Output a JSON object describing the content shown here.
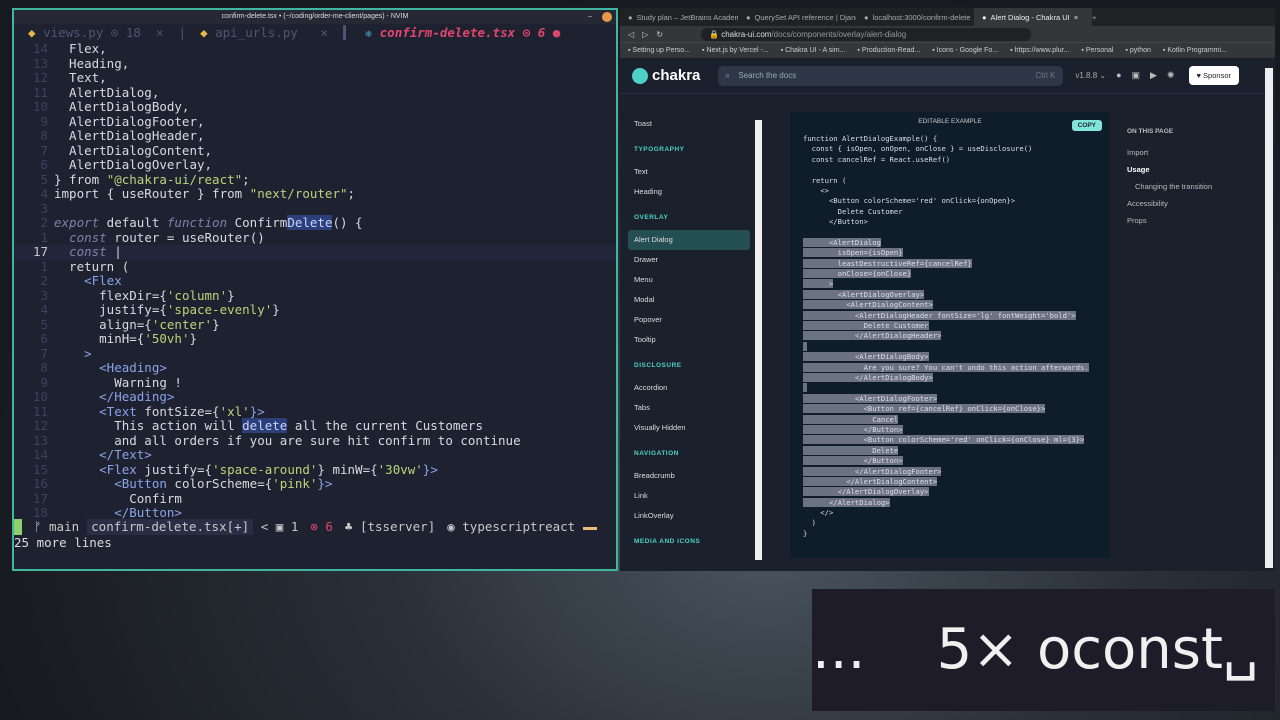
{
  "nvim": {
    "title": "confirm-delete.tsx • (~/coding/order-me-client/pages) - NVIM",
    "min": "–",
    "tabs": [
      {
        "label": "views.py ⊙ 18  ×",
        "icon": "python-icon",
        "active": false
      },
      {
        "label": "api_urls.py   ×",
        "icon": "python-icon",
        "active": false
      },
      {
        "label": "confirm-delete.tsx ⊙ 6 ●",
        "icon": "react-icon",
        "active": true
      }
    ],
    "lines": [
      {
        "n": "14",
        "s": [
          [
            "  Flex,",
            ""
          ]
        ]
      },
      {
        "n": "13",
        "s": [
          [
            "  Heading,",
            ""
          ]
        ]
      },
      {
        "n": "12",
        "s": [
          [
            "  Text,",
            ""
          ]
        ]
      },
      {
        "n": "11",
        "s": [
          [
            "  AlertDialog,",
            ""
          ]
        ]
      },
      {
        "n": "10",
        "s": [
          [
            "  AlertDialogBody,",
            ""
          ]
        ]
      },
      {
        "n": "9",
        "s": [
          [
            "  AlertDialogFooter,",
            ""
          ]
        ]
      },
      {
        "n": "8",
        "s": [
          [
            "  AlertDialogHeader,",
            ""
          ]
        ]
      },
      {
        "n": "7",
        "s": [
          [
            "  AlertDialogContent,",
            ""
          ]
        ]
      },
      {
        "n": "6",
        "s": [
          [
            "  AlertDialogOverlay,",
            ""
          ]
        ]
      },
      {
        "n": "5",
        "s": [
          [
            "} from ",
            ""
          ],
          [
            "\"@chakra-ui/react\"",
            "s"
          ],
          [
            ";",
            ""
          ]
        ]
      },
      {
        "n": "4",
        "s": [
          [
            "import { useRouter } from ",
            ""
          ],
          [
            "\"next/router\"",
            "s"
          ],
          [
            ";",
            ""
          ]
        ]
      },
      {
        "n": "3",
        "s": [
          [
            "",
            ""
          ]
        ]
      },
      {
        "n": "2",
        "s": [
          [
            "export",
            "k"
          ],
          [
            " default ",
            ""
          ],
          [
            "function",
            "k"
          ],
          [
            " Confirm",
            ""
          ],
          [
            "Delete",
            "hl"
          ],
          [
            "() {",
            ""
          ]
        ]
      },
      {
        "n": "1",
        "s": [
          [
            "  ",
            ""
          ],
          [
            "const",
            "k"
          ],
          [
            " router = useRouter()",
            ""
          ]
        ]
      },
      {
        "n": "17",
        "cur": true,
        "s": [
          [
            "  ",
            ""
          ],
          [
            "const",
            "k"
          ],
          [
            " |",
            ""
          ]
        ]
      },
      {
        "n": "1",
        "s": [
          [
            "  return (",
            ""
          ]
        ]
      },
      {
        "n": "2",
        "s": [
          [
            "    <Flex",
            "t"
          ]
        ]
      },
      {
        "n": "3",
        "s": [
          [
            "      flexDir={",
            ""
          ],
          [
            "'column'",
            "s"
          ],
          [
            "}",
            ""
          ]
        ]
      },
      {
        "n": "4",
        "s": [
          [
            "      justify={",
            ""
          ],
          [
            "'space-evenly'",
            "s"
          ],
          [
            "}",
            ""
          ]
        ]
      },
      {
        "n": "5",
        "s": [
          [
            "      align={",
            ""
          ],
          [
            "'center'",
            "s"
          ],
          [
            "}",
            ""
          ]
        ]
      },
      {
        "n": "6",
        "s": [
          [
            "      minH={",
            ""
          ],
          [
            "'50vh'",
            "s"
          ],
          [
            "}",
            ""
          ]
        ]
      },
      {
        "n": "7",
        "s": [
          [
            "    >",
            "t"
          ]
        ]
      },
      {
        "n": "8",
        "s": [
          [
            "      <Heading>",
            "t"
          ]
        ]
      },
      {
        "n": "9",
        "s": [
          [
            "        Warning !",
            ""
          ]
        ]
      },
      {
        "n": "10",
        "s": [
          [
            "      </Heading>",
            "t"
          ]
        ]
      },
      {
        "n": "11",
        "s": [
          [
            "      <Text",
            "t"
          ],
          [
            " fontSize={",
            ""
          ],
          [
            "'xl'",
            "s"
          ],
          [
            "}>",
            "t"
          ]
        ]
      },
      {
        "n": "12",
        "s": [
          [
            "        This action will ",
            ""
          ],
          [
            "delete",
            "hl"
          ],
          [
            " all the current Customers",
            ""
          ]
        ]
      },
      {
        "n": "13",
        "s": [
          [
            "        and all orders if you are sure hit confirm to continue",
            ""
          ]
        ]
      },
      {
        "n": "14",
        "s": [
          [
            "      </Text>",
            "t"
          ]
        ]
      },
      {
        "n": "15",
        "s": [
          [
            "      <Flex",
            "t"
          ],
          [
            " justify={",
            ""
          ],
          [
            "'space-around'",
            "s"
          ],
          [
            "} minW={",
            ""
          ],
          [
            "'30vw'",
            "s"
          ],
          [
            "}>",
            "t"
          ]
        ]
      },
      {
        "n": "16",
        "s": [
          [
            "        <Button",
            "t"
          ],
          [
            " colorScheme={",
            ""
          ],
          [
            "'pink'",
            "s"
          ],
          [
            "}>",
            "t"
          ]
        ]
      },
      {
        "n": "17",
        "s": [
          [
            "          Confirm",
            ""
          ]
        ]
      },
      {
        "n": "18",
        "s": [
          [
            "        </Button>",
            "t"
          ]
        ]
      }
    ],
    "status": {
      "branch": "ᚠ main",
      "file": "confirm-delete.tsx[+]",
      "sep": " < ",
      "warnings": "▣ 1",
      "errors": "⊗ 6",
      "lsp": "♣ [tsserver]",
      "filetype": "◉ typescriptreact"
    },
    "cmdline": "25 more lines"
  },
  "browser": {
    "tabs": [
      {
        "label": "Study plan – JetBrains Academy –"
      },
      {
        "label": "QuerySet API reference | Django d"
      },
      {
        "label": "localhost:3000/confirm-delete"
      },
      {
        "label": "Alert Dialog - Chakra UI",
        "active": true
      }
    ],
    "url_host": "chakra-ui.com",
    "url_path": "/docs/components/overlay/alert-dialog",
    "bookmarks": [
      "Setting up Perso...",
      "Next.js by Vercel -...",
      "Chakra UI - A sim...",
      "Production-Read...",
      "Icons - Google Fo...",
      "https://www.plur...",
      "Personal",
      "python",
      "Kotlin Programmi..."
    ],
    "header": {
      "logo": "chakra",
      "search_placeholder": "Search the docs",
      "shortcut": "Ctrl K",
      "version": "v1.8.8 ⌄",
      "sponsor": "♥ Sponsor"
    },
    "sidebar": [
      {
        "t": "Toast"
      },
      {
        "sec": "TYPOGRAPHY"
      },
      {
        "t": "Text"
      },
      {
        "t": "Heading"
      },
      {
        "sec": "OVERLAY"
      },
      {
        "t": "Alert Dialog",
        "active": true
      },
      {
        "t": "Drawer"
      },
      {
        "t": "Menu"
      },
      {
        "t": "Modal"
      },
      {
        "t": "Popover"
      },
      {
        "t": "Tooltip"
      },
      {
        "sec": "DISCLOSURE"
      },
      {
        "t": "Accordion"
      },
      {
        "t": "Tabs"
      },
      {
        "t": "Visually Hidden"
      },
      {
        "sec": "NAVIGATION"
      },
      {
        "t": "Breadcrumb"
      },
      {
        "t": "Link"
      },
      {
        "t": "LinkOverlay"
      },
      {
        "sec": "MEDIA AND ICONS"
      }
    ],
    "example": {
      "label": "EDITABLE EXAMPLE",
      "copy": "COPY",
      "code": [
        {
          "t": "function AlertDialogExample() {"
        },
        {
          "t": "  const { isOpen, onOpen, onClose } = useDisclosure()"
        },
        {
          "t": "  const cancelRef = React.useRef()"
        },
        {
          "t": ""
        },
        {
          "t": "  return ("
        },
        {
          "t": "    <>"
        },
        {
          "t": "      <Button colorScheme='red' onClick={onOpen}>"
        },
        {
          "t": "        Delete Customer"
        },
        {
          "t": "      </Button>"
        },
        {
          "t": ""
        },
        {
          "t": "      <AlertDialog",
          "sel": true
        },
        {
          "t": "        isOpen={isOpen}",
          "sel": true
        },
        {
          "t": "        leastDestructiveRef={cancelRef}",
          "sel": true
        },
        {
          "t": "        onClose={onClose}",
          "sel": true
        },
        {
          "t": "      >",
          "sel": true
        },
        {
          "t": "        <AlertDialogOverlay>",
          "sel": true
        },
        {
          "t": "          <AlertDialogContent>",
          "sel": true
        },
        {
          "t": "            <AlertDialogHeader fontSize='lg' fontWeight='bold'>",
          "sel": true
        },
        {
          "t": "              Delete Customer",
          "sel": true
        },
        {
          "t": "            </AlertDialogHeader>",
          "sel": true
        },
        {
          "t": "",
          "sel": true
        },
        {
          "t": "            <AlertDialogBody>",
          "sel": true
        },
        {
          "t": "              Are you sure? You can't undo this action afterwards.",
          "sel": true
        },
        {
          "t": "            </AlertDialogBody>",
          "sel": true
        },
        {
          "t": "",
          "sel": true
        },
        {
          "t": "            <AlertDialogFooter>",
          "sel": true
        },
        {
          "t": "              <Button ref={cancelRef} onClick={onClose}>",
          "sel": true
        },
        {
          "t": "                Cancel",
          "sel": true
        },
        {
          "t": "              </Button>",
          "sel": true
        },
        {
          "t": "              <Button colorScheme='red' onClick={onClose} ml={3}>",
          "sel": true
        },
        {
          "t": "                Delete",
          "sel": true
        },
        {
          "t": "              </Button>",
          "sel": true
        },
        {
          "t": "            </AlertDialogFooter>",
          "sel": true
        },
        {
          "t": "          </AlertDialogContent>",
          "sel": true
        },
        {
          "t": "        </AlertDialogOverlay>",
          "sel": true
        },
        {
          "t": "      </AlertDialog>",
          "sel": true
        },
        {
          "t": "    </>"
        },
        {
          "t": "  )"
        },
        {
          "t": "}"
        }
      ]
    },
    "toc": {
      "title": "ON THIS PAGE",
      "items": [
        "Import",
        "Usage",
        "Changing the transition",
        "Accessibility",
        "Props"
      ]
    }
  },
  "keystrokes": "...    5× oconst␣"
}
